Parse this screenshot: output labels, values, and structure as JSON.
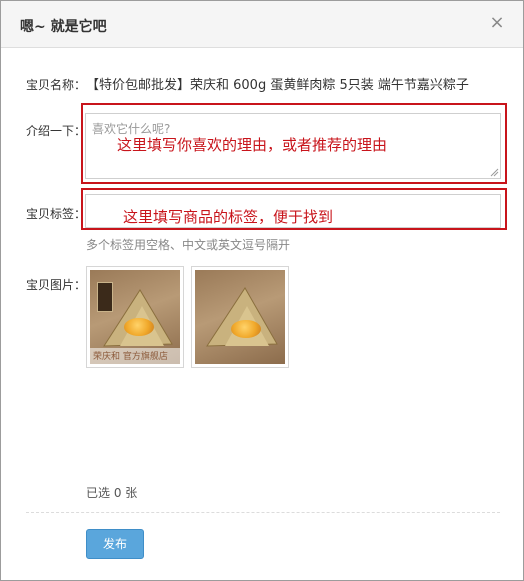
{
  "dialog": {
    "title": "嗯~ 就是它吧",
    "close_symbol": "×"
  },
  "form": {
    "name_label": "宝贝名称：",
    "product_name": "【特价包邮批发】荣庆和 600g 蛋黄鲜肉粽 5只装 端午节嘉兴粽子",
    "intro_label": "介绍一下：",
    "intro_placeholder": "喜欢它什么呢?",
    "intro_annotation": "这里填写你喜欢的理由，或者推荐的理由",
    "tags_label": "宝贝标签：",
    "tags_annotation": "这里填写商品的标签，便于找到",
    "tags_hint": "多个标签用空格、中文或英文逗号隔开",
    "images_label": "宝贝图片：",
    "image_watermark": "荣庆和 官方旗舰店",
    "selected_count": "已选 0 张",
    "publish_label": "发布"
  },
  "colors": {
    "annotation_red": "#c8141b",
    "button_blue": "#5aa6dc"
  },
  "icons": [
    "close-icon",
    "resize-grip-icon"
  ]
}
